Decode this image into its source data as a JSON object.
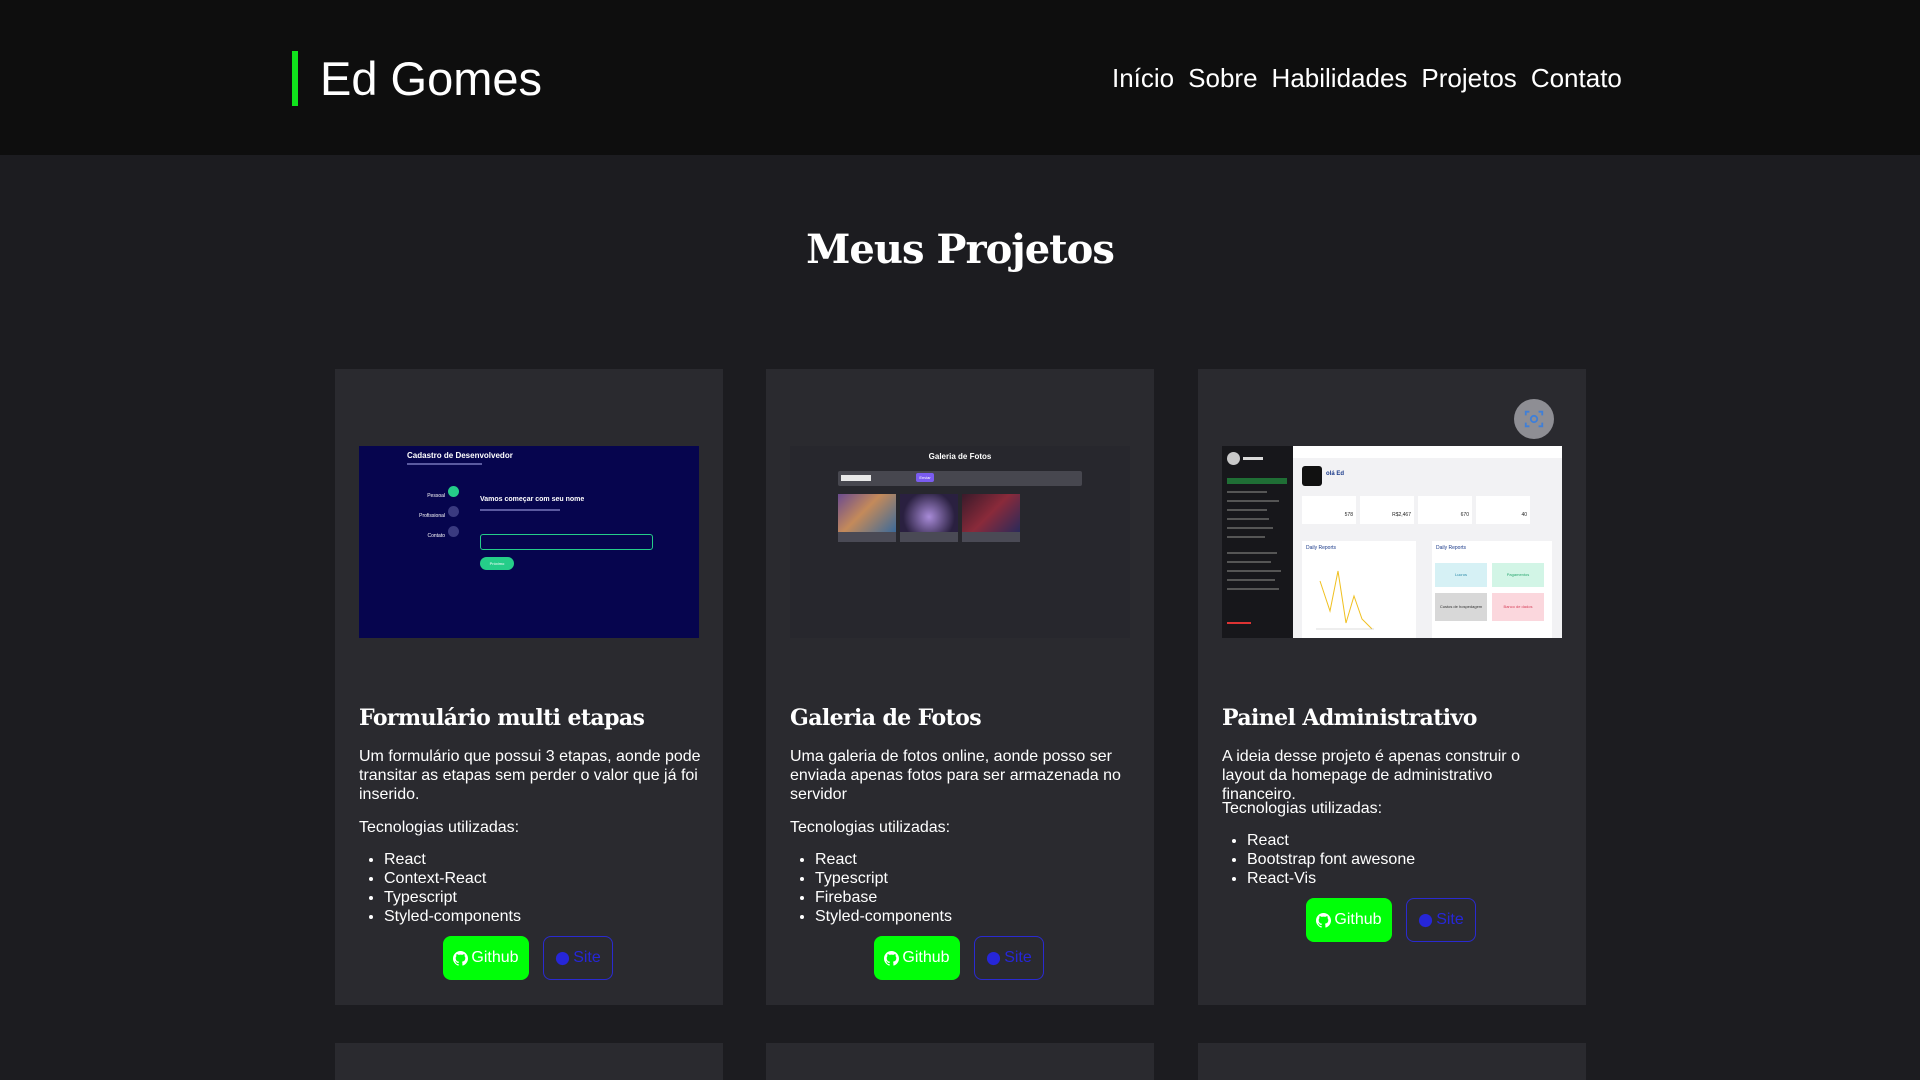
{
  "header": {
    "brand": "Ed Gomes",
    "nav": [
      "Início",
      "Sobre",
      "Habilidades",
      "Projetos",
      "Contato"
    ]
  },
  "section": {
    "title": "Meus Projetos"
  },
  "projects": [
    {
      "title": "Formulário multi etapas",
      "description": "Um formulário que possui 3 etapas, aonde pode transitar as etapas sem perder o valor que já foi inserido.",
      "tech_label": "Tecnologias utilizadas:",
      "technologies": [
        "React",
        "Context-React",
        "Typescript",
        "Styled-components"
      ],
      "github_label": "Github",
      "site_label": "Site",
      "preview": {
        "heading": "Cadastro de Desenvolvedor",
        "step_title": "Vamos começar com seu nome",
        "steps": [
          "Pessoal",
          "Profissional",
          "Contato"
        ],
        "button": "Próximo"
      }
    },
    {
      "title": "Galeria de Fotos",
      "description": "Uma galeria de fotos online, aonde posso ser enviada apenas fotos para ser armazenada no servidor",
      "tech_label": "Tecnologias utilizadas:",
      "technologies": [
        "React",
        "Typescript",
        "Firebase",
        "Styled-components"
      ],
      "github_label": "Github",
      "site_label": "Site",
      "preview": {
        "heading": "Galeria de Fotos",
        "upload_button": "Enviar"
      }
    },
    {
      "title": "Painel Administrativo",
      "description": "A ideia desse projeto é apenas construir o layout da homepage de administrativo financeiro.",
      "tech_label": "Tecnologias utilizadas:",
      "technologies": [
        "React",
        "Bootstrap font awesone",
        "React-Vis"
      ],
      "github_label": "Github",
      "site_label": "Site",
      "preview": {
        "greeting": "olá Ed",
        "stats": [
          "578",
          "R$2,467",
          "670",
          "40"
        ],
        "chart_title": "Daily Reports",
        "reports_title": "Daily Reports",
        "tiles": [
          "Lucros",
          "Pagamentos",
          "Custos de hospedagem",
          "Banco de dados"
        ]
      }
    }
  ],
  "colors": {
    "accent": "#00ff08",
    "brand_bar": "#10e31c",
    "header_bg": "#0e0e0e",
    "page_bg": "#1c1c20",
    "card_bg": "#2a2a2f",
    "site_link": "#2626d8"
  },
  "icons": {
    "github": "github-icon",
    "site": "globe-icon",
    "screenshot": "screenshot-capture-icon"
  }
}
